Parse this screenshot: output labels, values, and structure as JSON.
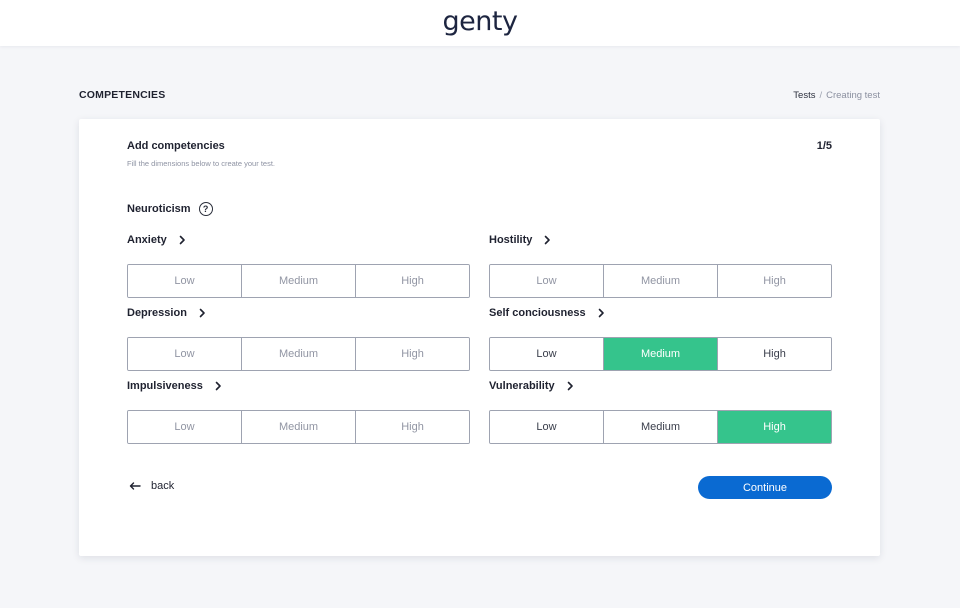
{
  "header": {
    "logo": "genty"
  },
  "page": {
    "section_title": "COMPETENCIES",
    "breadcrumb": {
      "link": "Tests",
      "separator": "/",
      "current": "Creating test"
    }
  },
  "card": {
    "title": "Add competencies",
    "subtitle": "Fill the dimensions below to create your test.",
    "step": "1/5",
    "group": {
      "label": "Neuroticism",
      "help_glyph": "?"
    },
    "dimensions": [
      {
        "label": "Anxiety",
        "options": [
          "Low",
          "Medium",
          "High"
        ],
        "selected": null
      },
      {
        "label": "Hostility",
        "options": [
          "Low",
          "Medium",
          "High"
        ],
        "selected": null
      },
      {
        "label": "Depression",
        "options": [
          "Low",
          "Medium",
          "High"
        ],
        "selected": null
      },
      {
        "label": "Self conciousness",
        "options": [
          "Low",
          "Medium",
          "High"
        ],
        "selected": "Medium"
      },
      {
        "label": "Impulsiveness",
        "options": [
          "Low",
          "Medium",
          "High"
        ],
        "selected": null
      },
      {
        "label": "Vulnerability",
        "options": [
          "Low",
          "Medium",
          "High"
        ],
        "selected": "High"
      }
    ],
    "back_label": "back",
    "continue_label": "Continue"
  },
  "colors": {
    "selected": "#35c48c",
    "primary": "#0a6ad2",
    "background": "#f5f6f9"
  },
  "icons": {
    "help": "question-circle-icon",
    "chevron": "chevron-right-icon",
    "back": "arrow-left-icon"
  }
}
